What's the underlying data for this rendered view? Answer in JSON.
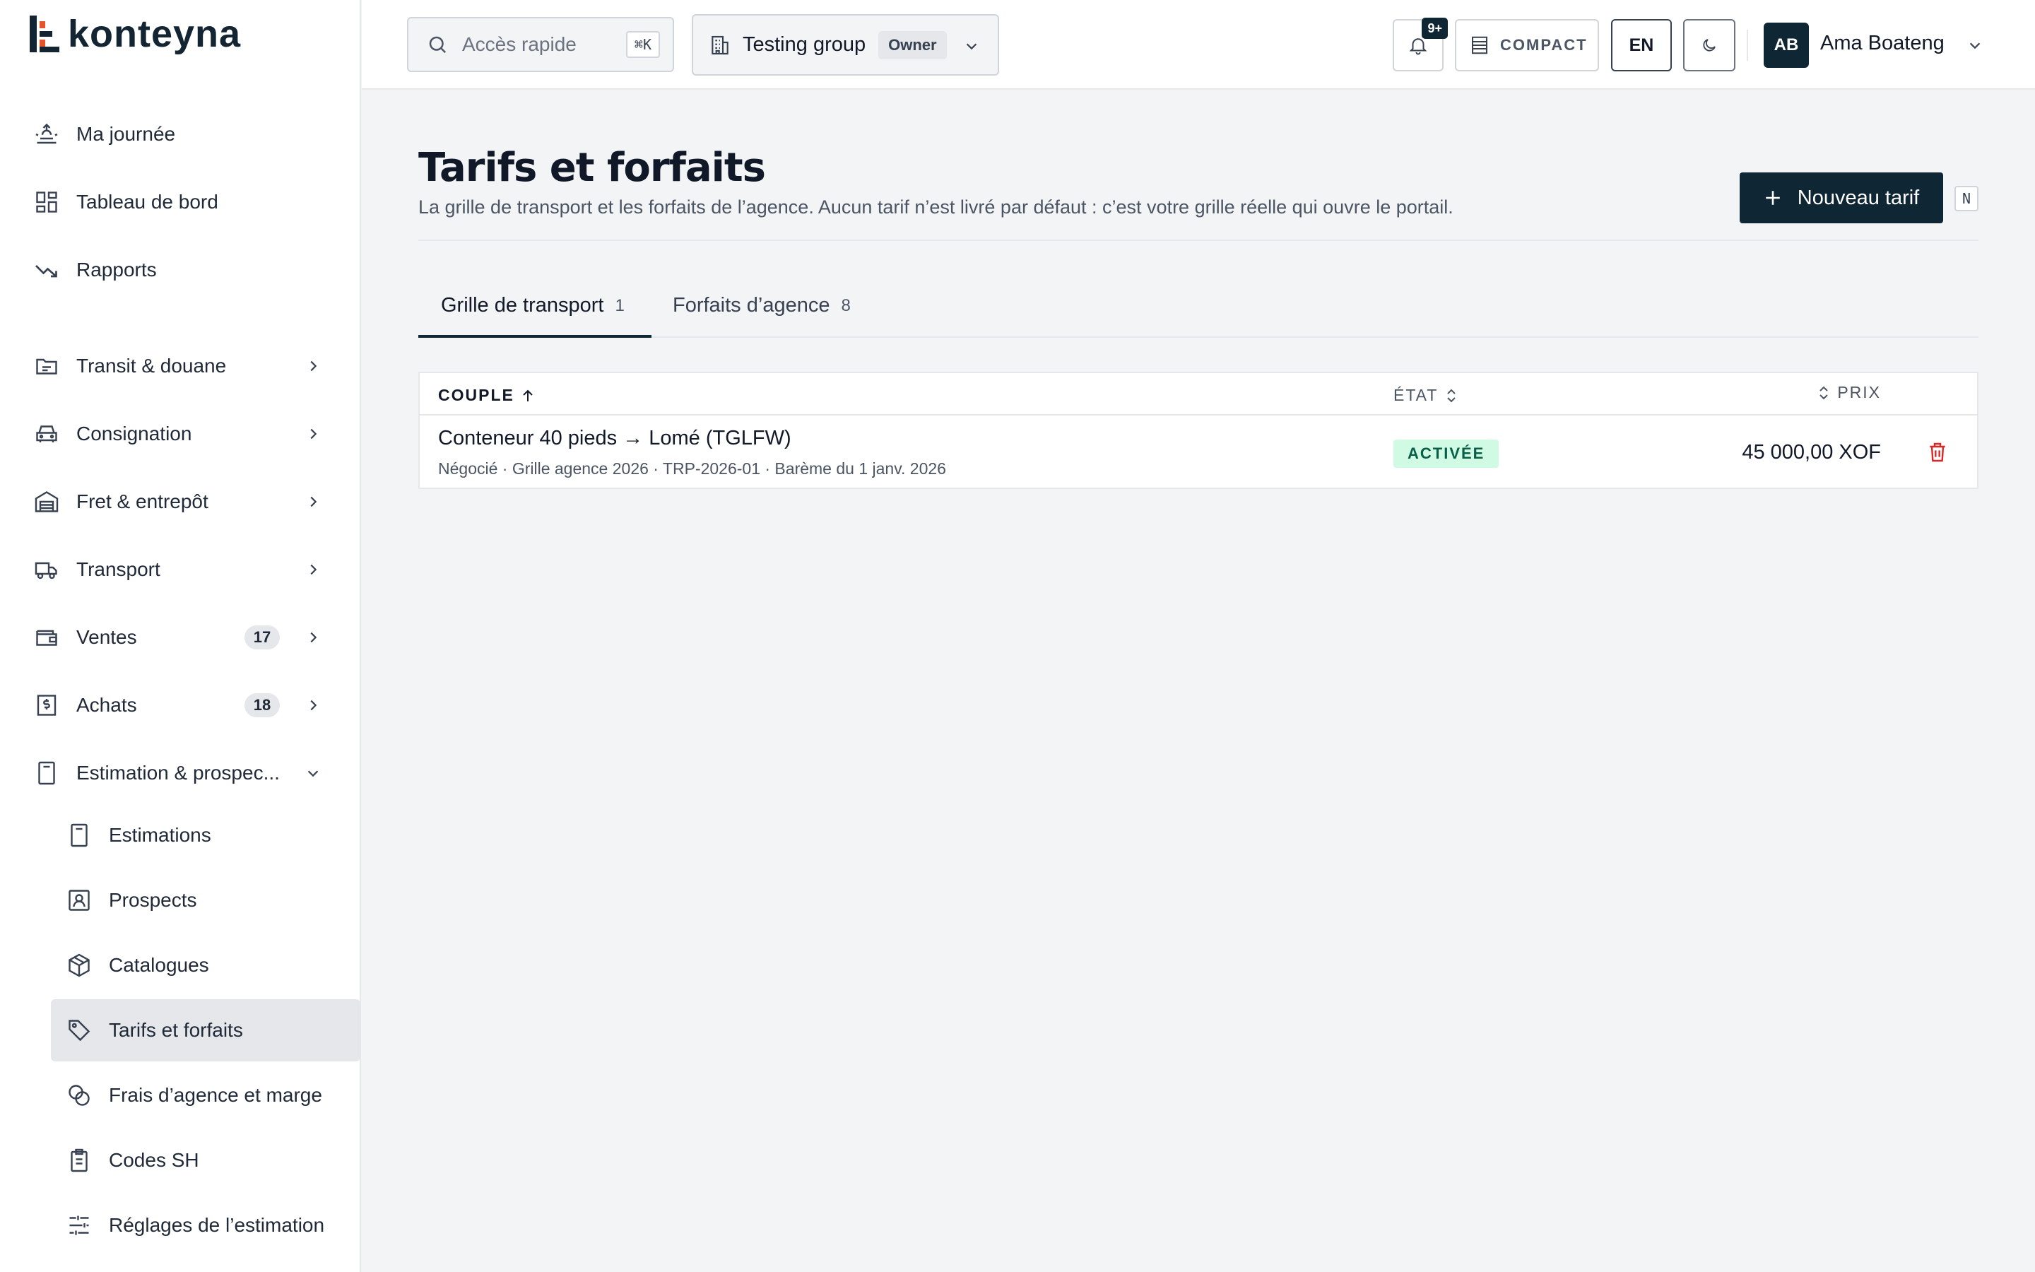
{
  "app": {
    "logo_text": "konteyna"
  },
  "sidebar": {
    "items": [
      {
        "label": "Ma journée",
        "icon": "sunrise-icon"
      },
      {
        "label": "Tableau de bord",
        "icon": "dashboard-icon"
      },
      {
        "label": "Rapports",
        "icon": "trending-down-icon"
      },
      {
        "label": "Transit & douane",
        "icon": "folder-icon"
      },
      {
        "label": "Consignation",
        "icon": "car-icon"
      },
      {
        "label": "Fret & entrepôt",
        "icon": "warehouse-icon"
      },
      {
        "label": "Transport",
        "icon": "truck-icon"
      },
      {
        "label": "Ventes",
        "icon": "wallet-icon",
        "badge": "17"
      },
      {
        "label": "Achats",
        "icon": "receipt-icon",
        "badge": "18"
      },
      {
        "label": "Estimation & prospec...",
        "icon": "calculator-icon"
      }
    ],
    "subitems": [
      {
        "label": "Estimations",
        "icon": "calculator-icon"
      },
      {
        "label": "Prospects",
        "icon": "contact-icon"
      },
      {
        "label": "Catalogues",
        "icon": "package-icon"
      },
      {
        "label": "Tarifs et forfaits",
        "icon": "tag-icon",
        "active": true
      },
      {
        "label": "Frais d’agence et marge",
        "icon": "coins-icon"
      },
      {
        "label": "Codes SH",
        "icon": "clipboard-icon"
      },
      {
        "label": "Réglages de l’estimation",
        "icon": "sliders-icon"
      }
    ]
  },
  "topbar": {
    "search_placeholder": "Accès rapide",
    "search_shortcut": "⌘K",
    "org_name": "Testing group",
    "org_role": "Owner",
    "notif_count": "9+",
    "compact_label": "COMPACT",
    "lang": "EN",
    "user_initials": "AB",
    "user_name": "Ama Boateng"
  },
  "page": {
    "title": "Tarifs et forfaits",
    "subtitle": "La grille de transport et les forfaits de l’agence. Aucun tarif n’est livré par défaut : c’est votre grille réelle qui ouvre le portail.",
    "new_button": "Nouveau tarif",
    "new_shortcut": "N"
  },
  "tabs": [
    {
      "label": "Grille de transport",
      "count": "1"
    },
    {
      "label": "Forfaits d’agence",
      "count": "8"
    }
  ],
  "table": {
    "headers": {
      "couple": "COUPLE",
      "etat": "ÉTAT",
      "prix": "PRIX"
    },
    "rows": [
      {
        "route": "Conteneur 40 pieds → Lomé (TGLFW)",
        "meta": "Négocié · Grille agence 2026 · TRP-2026-01 · Barème du 1 janv. 2026",
        "status": "ACTIVÉE",
        "price": "45 000,00 XOF"
      }
    ]
  },
  "colors": {
    "brand": "#0f2634",
    "accent": "#e8542a",
    "status_active_bg": "#d1fae5",
    "status_active_fg": "#065f46",
    "danger": "#dc2626"
  }
}
